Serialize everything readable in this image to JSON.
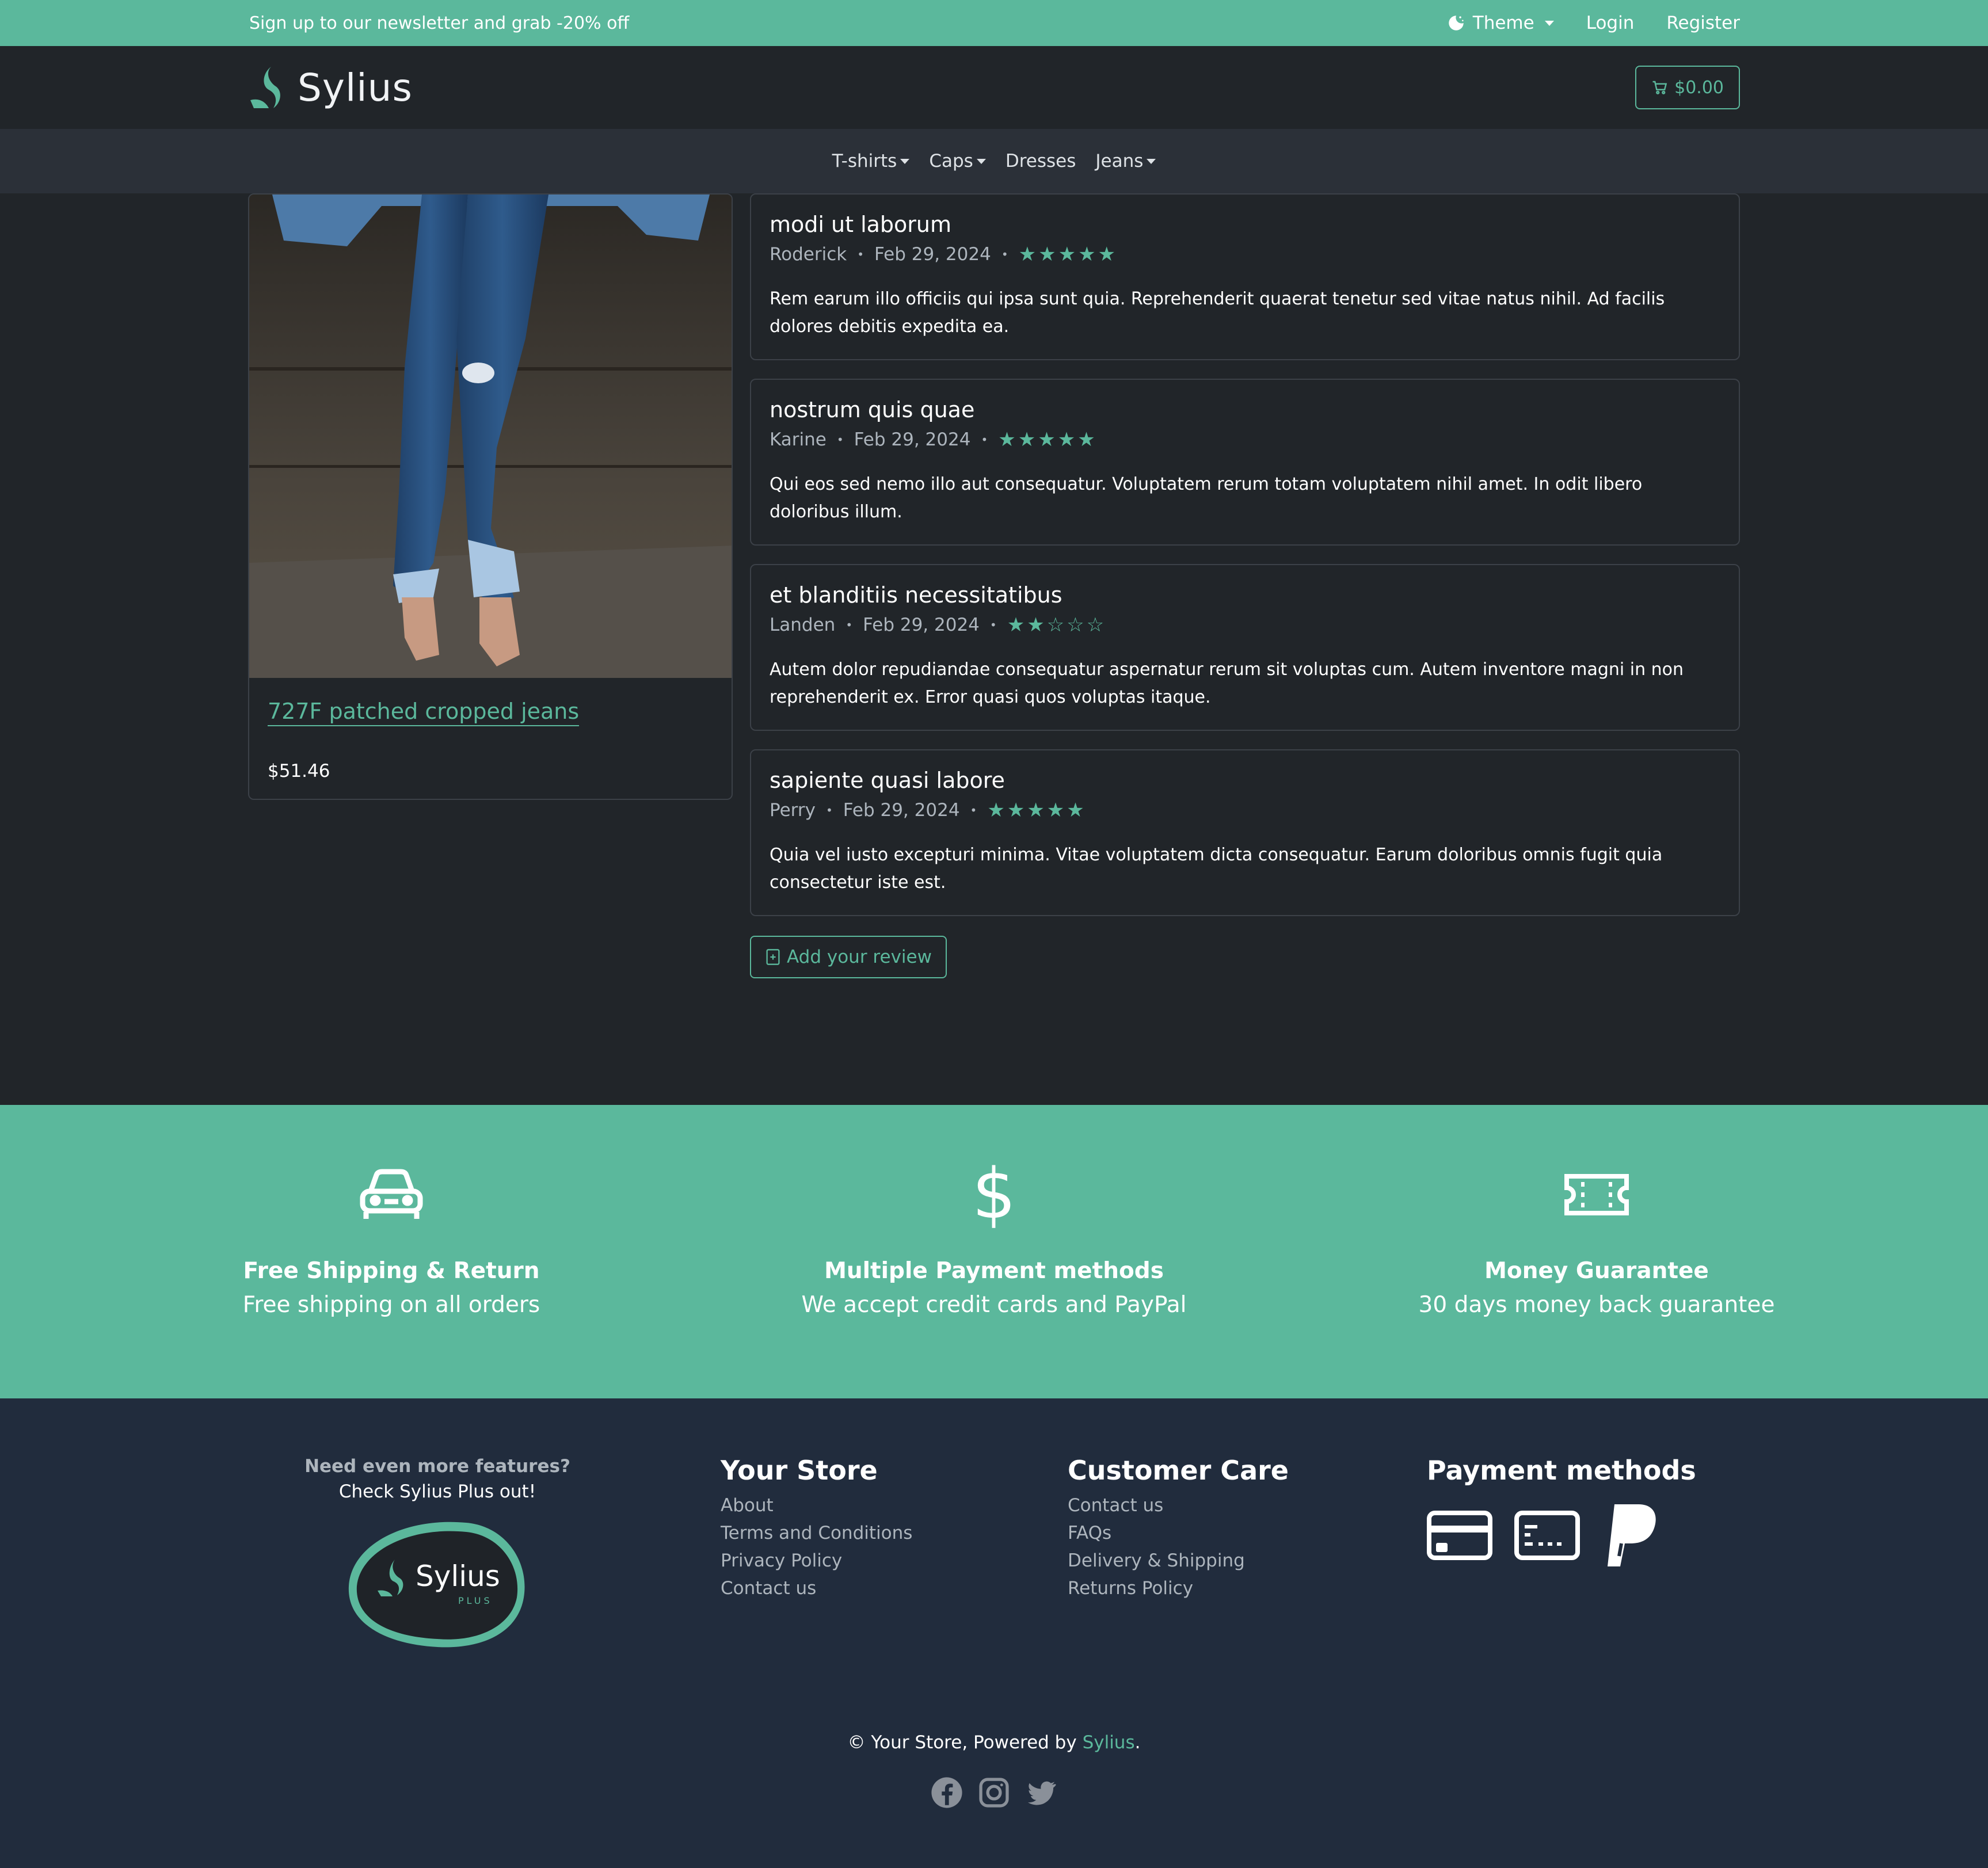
{
  "topbar": {
    "promo": "Sign up to our newsletter and grab -20% off",
    "theme_label": "Theme",
    "login_label": "Login",
    "register_label": "Register"
  },
  "header": {
    "logo_text": "Sylius",
    "cart_total": "$0.00"
  },
  "nav": {
    "items": [
      {
        "label": "T-shirts",
        "has_dropdown": true
      },
      {
        "label": "Caps",
        "has_dropdown": true
      },
      {
        "label": "Dresses",
        "has_dropdown": false
      },
      {
        "label": "Jeans",
        "has_dropdown": true
      }
    ]
  },
  "product": {
    "name": "727F patched cropped jeans",
    "price": "$51.46"
  },
  "reviews": [
    {
      "title": "modi ut laborum",
      "author": "Roderick",
      "date": "Feb 29, 2024",
      "rating": 5,
      "body": "Rem earum illo officiis qui ipsa sunt quia. Reprehenderit quaerat tenetur sed vitae natus nihil. Ad facilis dolores debitis expedita ea."
    },
    {
      "title": "nostrum quis quae",
      "author": "Karine",
      "date": "Feb 29, 2024",
      "rating": 5,
      "body": "Qui eos sed nemo illo aut consequatur. Voluptatem rerum totam voluptatem nihil amet. In odit libero doloribus illum."
    },
    {
      "title": "et blanditiis necessitatibus",
      "author": "Landen",
      "date": "Feb 29, 2024",
      "rating": 2,
      "body": "Autem dolor repudiandae consequatur aspernatur rerum sit voluptas cum. Autem inventore magni in non reprehenderit ex. Error quasi quos voluptas itaque."
    },
    {
      "title": "sapiente quasi labore",
      "author": "Perry",
      "date": "Feb 29, 2024",
      "rating": 5,
      "body": "Quia vel iusto excepturi minima. Vitae voluptatem dicta consequatur. Earum doloribus omnis fugit quia consectetur iste est."
    }
  ],
  "add_review_label": "Add your review",
  "features": [
    {
      "icon": "car-icon",
      "title": "Free Shipping & Return",
      "desc": "Free shipping on all orders"
    },
    {
      "icon": "dollar-icon",
      "title": "Multiple Payment methods",
      "desc": "We accept credit cards and PayPal"
    },
    {
      "icon": "ticket-icon",
      "title": "Money Guarantee",
      "desc": "30 days money back guarantee"
    }
  ],
  "footer": {
    "plus_need": "Need even more features?",
    "plus_check": "Check Sylius Plus out!",
    "plus_logo_text": "Sylius",
    "plus_logo_sub": "PLUS",
    "your_store": {
      "title": "Your Store",
      "links": [
        "About",
        "Terms and Conditions",
        "Privacy Policy",
        "Contact us"
      ]
    },
    "customer_care": {
      "title": "Customer Care",
      "links": [
        "Contact us",
        "FAQs",
        "Delivery & Shipping",
        "Returns Policy"
      ]
    },
    "payment": {
      "title": "Payment methods",
      "icons": [
        "credit-card-icon",
        "card-icon",
        "paypal-icon"
      ]
    },
    "copyright_prefix": "© Your Store, Powered by ",
    "copyright_brand": "Sylius",
    "copyright_suffix": ".",
    "social": [
      "facebook-icon",
      "instagram-icon",
      "twitter-icon"
    ]
  },
  "colors": {
    "accent": "#5bb89c",
    "bg": "#212529",
    "footer_bg": "#212c3d",
    "nav_bg": "#2b3038"
  }
}
